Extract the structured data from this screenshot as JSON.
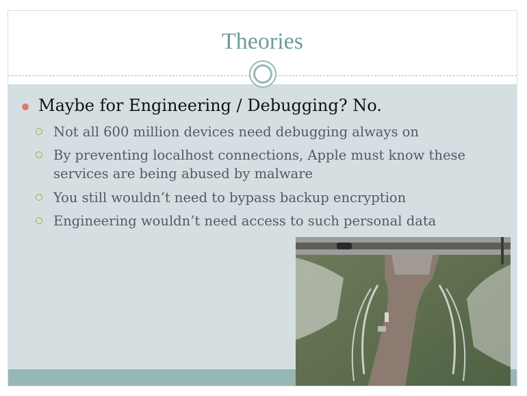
{
  "slide": {
    "title": "Theories",
    "main_bullet": "Maybe for Engineering / Debugging? No.",
    "sub_bullets": [
      "Not all 600 million devices need debugging always on",
      "By preventing localhost connections, Apple must know these services are being abused by malware",
      "You still wouldn’t need to bypass backup encryption",
      "Engineering wouldn’t need access to such personal data"
    ],
    "colors": {
      "title": "#6f9a9a",
      "content_background": "#d5dfe2",
      "accent_band": "#97b6b6",
      "bullet_dot": "#e07a6c",
      "sub_bullet_ring": "#b8a24a"
    },
    "image": {
      "icon": "aerial-photo-snowy-path"
    }
  }
}
